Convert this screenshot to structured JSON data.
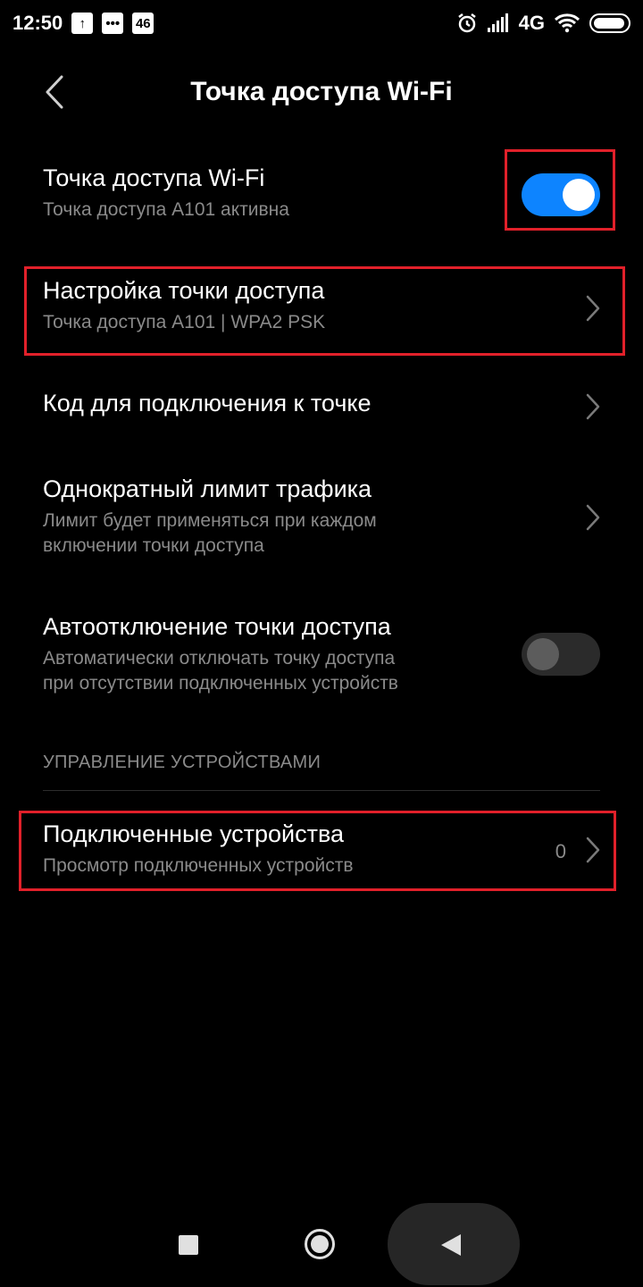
{
  "status_bar": {
    "time": "12:50",
    "notification_icons": [
      "upload-icon",
      "message-icon"
    ],
    "badge": "46",
    "network": "4G",
    "right_icons": [
      "alarm-icon",
      "signal-icon",
      "wifi-icon",
      "battery-icon"
    ]
  },
  "header": {
    "title": "Точка доступа Wi-Fi"
  },
  "settings": {
    "hotspot": {
      "title": "Точка доступа Wi-Fi",
      "subtitle": "Точка доступа A101 активна",
      "enabled": true
    },
    "hotspot_config": {
      "title": "Настройка точки доступа",
      "subtitle": "Точка доступа A101 | WPA2 PSK"
    },
    "connect_code": {
      "title": "Код для подключения к точке"
    },
    "traffic_limit": {
      "title": "Однократный лимит трафика",
      "subtitle_line1": "Лимит будет применяться при каждом",
      "subtitle_line2": "включении точки доступа"
    },
    "auto_off": {
      "title": "Автоотключение точки доступа",
      "subtitle_line1": "Автоматически отключать точку доступа",
      "subtitle_line2": "при отсутствии подключенных устройств",
      "enabled": false
    }
  },
  "device_management": {
    "section_title": "УПРАВЛЕНИЕ УСТРОЙСТВАМИ",
    "connected_devices": {
      "title": "Подключенные устройства",
      "subtitle": "Просмотр подключенных устройств",
      "count": "0"
    }
  },
  "colors": {
    "accent": "#0d84ff",
    "highlight": "#e1202a",
    "background": "#000000",
    "secondary_text": "#8a8a8a"
  }
}
